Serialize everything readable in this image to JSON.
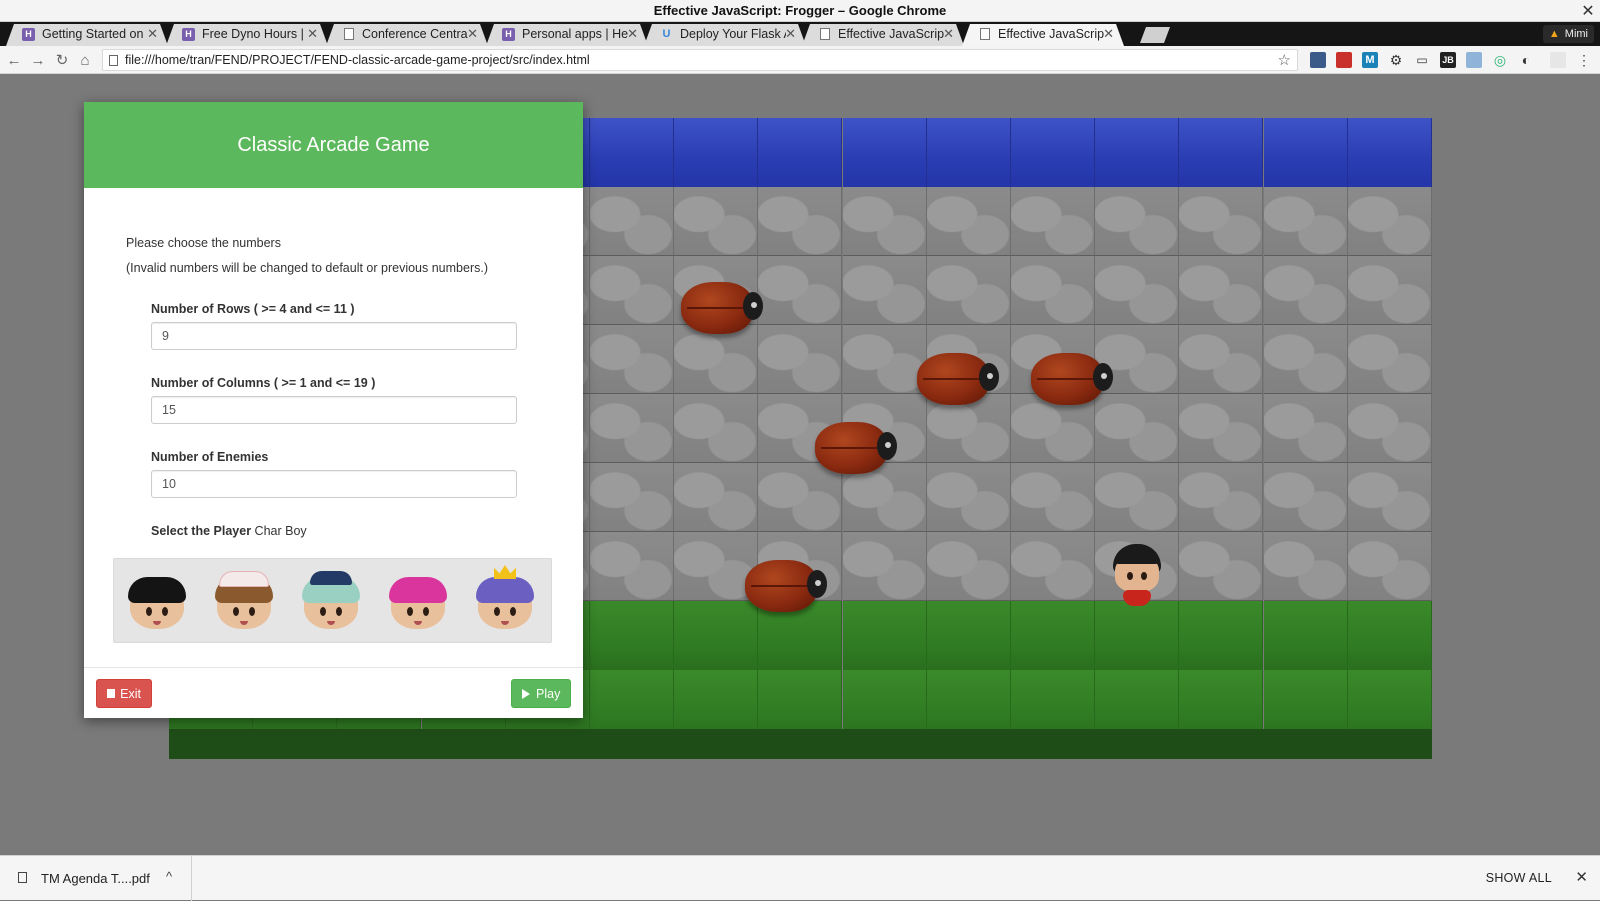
{
  "window": {
    "title": "Effective JavaScript: Frogger – Google Chrome"
  },
  "tabs": [
    {
      "title": "Getting Started on",
      "icon": "heroku-icon"
    },
    {
      "title": "Free Dyno Hours | ",
      "icon": "heroku-icon"
    },
    {
      "title": "Conference Central",
      "icon": "document-icon"
    },
    {
      "title": "Personal apps | Her",
      "icon": "heroku-icon"
    },
    {
      "title": "Deploy Your Flask A",
      "icon": "flask-icon"
    },
    {
      "title": "Effective JavaScript",
      "icon": "document-icon"
    },
    {
      "title": "Effective JavaScript",
      "icon": "document-icon",
      "active": true
    }
  ],
  "profile": {
    "name": "Mimi"
  },
  "toolbar": {
    "url": "file:///home/tran/FEND/PROJECT/FEND-classic-arcade-game-project/src/index.html"
  },
  "dialog": {
    "title": "Classic Arcade Game",
    "instruction_1": "Please choose the numbers",
    "instruction_2": "(Invalid numbers will be changed to default or previous numbers.)",
    "rows_label": "Number of Rows ( >= 4 and <= 11 )",
    "rows_value": "9",
    "cols_label": "Number of Columns ( >= 1 and <= 19 )",
    "cols_value": "15",
    "enemies_label": "Number of Enemies",
    "enemies_value": "10",
    "player_label": "Select the Player",
    "player_value": "Char Boy",
    "characters": [
      "char-boy",
      "char-cat-girl",
      "char-horn-girl",
      "char-pink-girl",
      "char-princess-girl"
    ],
    "exit_label": "Exit",
    "play_label": "Play"
  },
  "downloads": {
    "file": "TM Agenda T....pdf",
    "show_all": "SHOW ALL"
  },
  "colors": {
    "header_green": "#5cb85c",
    "exit_red": "#d9534f",
    "water": "#2a3db3",
    "grass": "#2f7a22"
  }
}
